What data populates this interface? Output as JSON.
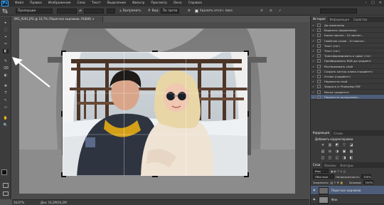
{
  "app": {
    "logo": "Ps"
  },
  "menu": [
    "Файл",
    "Правка",
    "Изображение",
    "Слои",
    "Текст",
    "Выделение",
    "Фильтр",
    "Просмотр",
    "Окно",
    "Справка"
  ],
  "window_controls": [
    "–",
    "□",
    "✕"
  ],
  "options": {
    "ratio": "Пропорции",
    "straighten": "Выпрямить",
    "view_label": "Вид:",
    "view_value": "По трети",
    "delete_pixels": "Удалить отсеч. пикс."
  },
  "document": {
    "tab_title": "IMG_9261.JPG @ 16,7% (Перегнал оодчикие, RGB/8) ×",
    "zoom": "16,67%",
    "doc_size": "Док: 16,2М/16,2М"
  },
  "tools": [
    "▸",
    "⬚",
    "⌖",
    "✂",
    "◧",
    "✎",
    "⌫",
    "◐",
    "✥",
    "T",
    "↖",
    "▭",
    "✋",
    "🔍"
  ],
  "history_panel": {
    "tabs": [
      "История",
      "Информация",
      "Свойства"
    ],
    "items": [
      "До изменения",
      "Вырезать (выделение)",
      "Канал пиксел - 10 пиксел...",
      "Свойства слоев - 10 пиксел...",
      "Текст (тэг)",
      "Текст (тэг)",
      "Трансформировать и сдвиг (тэг)",
      "Преобразовать RGB до градиент",
      "Растеризовать слой",
      "Создать контур клипа (градиент)",
      "Уголок (градиент)",
      "Перенести слой",
      "Закрыть in Photoshop PDF",
      "Маска градиента",
      "Перенести оолодчнике..."
    ],
    "selected_index": 14
  },
  "adjustments_panel": {
    "tabs": [
      "Коррекция",
      "Стили"
    ],
    "title": "Добавить корректировки",
    "row1": [
      "☀",
      "▥",
      "◩",
      "▽",
      "◪"
    ],
    "row2": [
      "▤",
      "⚖",
      "◑",
      "▣",
      "▦"
    ],
    "row3": [
      "◫",
      "◰",
      "◱",
      "◨",
      "◧"
    ]
  },
  "layers_panel": {
    "tabs": [
      "Слои",
      "Каналы",
      "Контуры"
    ],
    "kind_label": "Вид",
    "blend_mode": "Обычные",
    "opacity_label": "Непрозрачность:",
    "opacity_value": "100%",
    "lock_label": "Закрепить:",
    "fill_label": "Заливка:",
    "fill_value": "100%",
    "layers": [
      {
        "name": "Перегнал оодчиков",
        "selected": true
      },
      {
        "name": "Фон",
        "selected": false
      }
    ]
  },
  "colors": {
    "accent": "#31a8ff",
    "selection": "#4d5d7a"
  }
}
